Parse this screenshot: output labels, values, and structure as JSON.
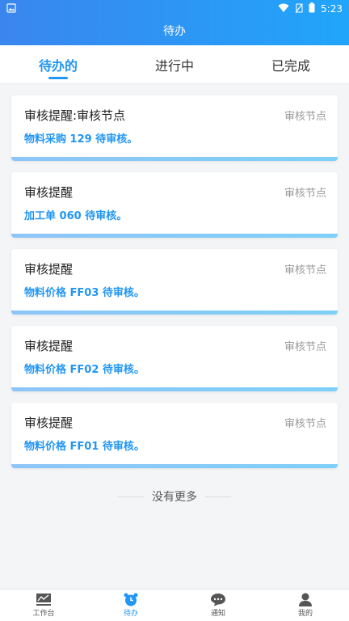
{
  "status_bar": {
    "time": "5:23"
  },
  "header": {
    "title": "待办"
  },
  "tabs": [
    {
      "label": "待办的",
      "active": true
    },
    {
      "label": "进行中",
      "active": false
    },
    {
      "label": "已完成",
      "active": false
    }
  ],
  "cards": [
    {
      "title": "审核提醒:审核节点",
      "tag": "审核节点",
      "desc": "物料采购 129 待审核。"
    },
    {
      "title": "审核提醒",
      "tag": "审核节点",
      "desc": "加工单 060 待审核。"
    },
    {
      "title": "审核提醒",
      "tag": "审核节点",
      "desc": "物料价格 FF03 待审核。"
    },
    {
      "title": "审核提醒",
      "tag": "审核节点",
      "desc": "物料价格 FF02 待审核。"
    },
    {
      "title": "审核提醒",
      "tag": "审核节点",
      "desc": "物料价格 FF01 待审核。"
    }
  ],
  "footer_text": "没有更多",
  "bottom_nav": [
    {
      "label": "工作台",
      "icon": "chart-icon"
    },
    {
      "label": "待办",
      "icon": "clock-icon",
      "active": true
    },
    {
      "label": "通知",
      "icon": "chat-icon"
    },
    {
      "label": "我的",
      "icon": "person-icon"
    }
  ],
  "colors": {
    "accent": "#2196f3",
    "header_start": "#3a86ee",
    "header_end": "#21a5fb"
  }
}
